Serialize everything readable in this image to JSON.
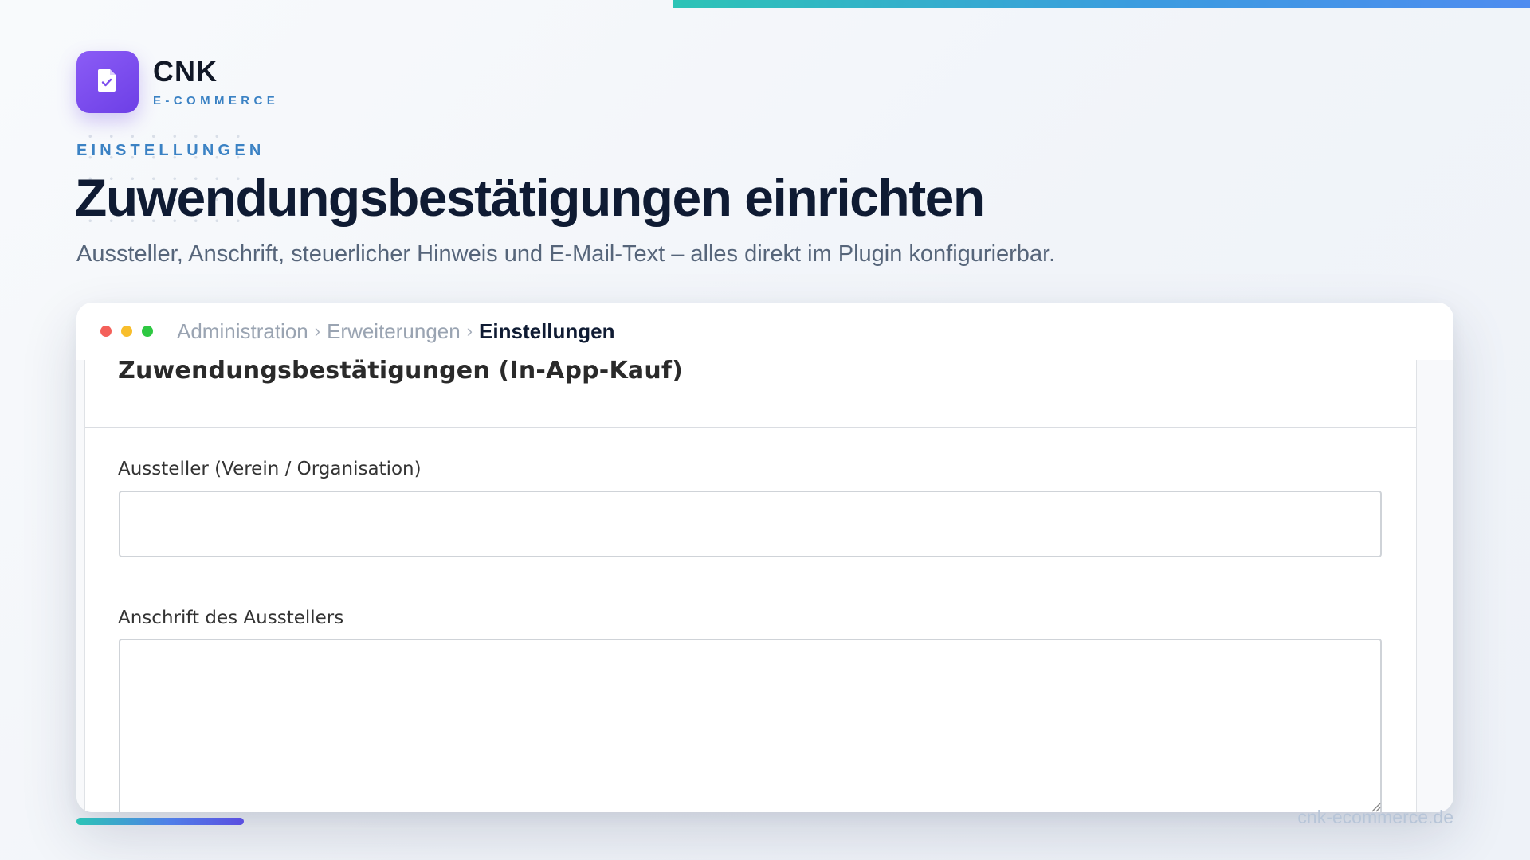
{
  "brand": {
    "name": "CNK",
    "tagline": "E-COMMERCE",
    "icon": "document-check-icon",
    "accent_color": "#7c4dee"
  },
  "hero": {
    "eyebrow": "EINSTELLUNGEN",
    "title": "Zuwendungsbestätigungen einrichten",
    "subtitle": "Aussteller, Anschrift, steuerlicher Hinweis und E-Mail-Text – alles direkt im Plugin konfigurierbar."
  },
  "window": {
    "breadcrumbs": [
      "Administration",
      "Erweiterungen",
      "Einstellungen"
    ],
    "separator": "›",
    "panel_title": "Zuwendungsbestätigungen (In-App-Kauf)",
    "fields": [
      {
        "label": "Aussteller (Verein / Organisation)",
        "value": "",
        "placeholder": ""
      },
      {
        "label": "Anschrift des Ausstellers",
        "value": "",
        "placeholder": ""
      }
    ]
  },
  "footer": {
    "url": "cnk-ecommerce.de"
  }
}
